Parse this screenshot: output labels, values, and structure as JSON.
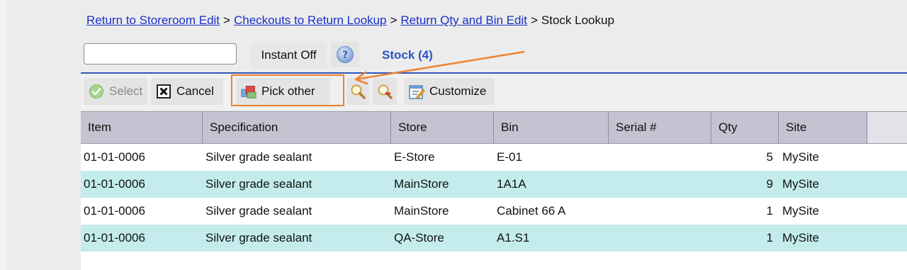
{
  "breadcrumb": {
    "links": [
      "Return to Storeroom Edit",
      "Checkouts to Return Lookup",
      "Return Qty and Bin Edit"
    ],
    "separator": ">",
    "current": "Stock Lookup"
  },
  "search": {
    "value": "",
    "placeholder": ""
  },
  "instant_label": "Instant Off",
  "help_icon": "help-question-icon",
  "stock_title": "Stock (4)",
  "toolbar": {
    "select_label": "Select",
    "cancel_label": "Cancel",
    "pick_other_label": "Pick other",
    "customize_label": "Customize",
    "icons": [
      "check-circle-icon",
      "cancel-x-icon",
      "pick-other-icon",
      "magnifier-icon",
      "magnifier-clear-icon",
      "customize-icon"
    ]
  },
  "colors": {
    "accent": "#2b54c6",
    "link": "#1a31c9",
    "highlight": "#f08030",
    "row_alt": "#c4ecec",
    "header_bg": "#c3c3d1"
  },
  "table": {
    "columns": [
      "Item",
      "Specification",
      "Store",
      "Bin",
      "Serial #",
      "Qty",
      "Site"
    ],
    "rows": [
      {
        "item": "01-01-0006",
        "spec": "Silver grade sealant",
        "store": "E-Store",
        "bin": "E-01",
        "serial": "",
        "qty": "5",
        "site": "MySite"
      },
      {
        "item": "01-01-0006",
        "spec": "Silver grade sealant",
        "store": "MainStore",
        "bin": "1A1A",
        "serial": "",
        "qty": "9",
        "site": "MySite"
      },
      {
        "item": "01-01-0006",
        "spec": "Silver grade sealant",
        "store": "MainStore",
        "bin": "Cabinet 66 A",
        "serial": "",
        "qty": "1",
        "site": "MySite"
      },
      {
        "item": "01-01-0006",
        "spec": "Silver grade sealant",
        "store": "QA-Store",
        "bin": "A1.S1",
        "serial": "",
        "qty": "1",
        "site": "MySite"
      }
    ]
  }
}
